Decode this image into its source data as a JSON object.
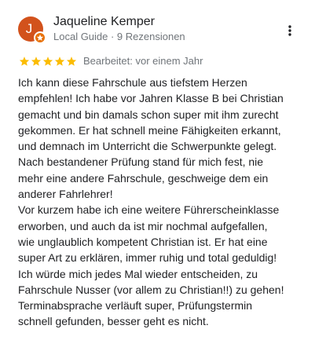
{
  "author": {
    "avatar_initial": "J",
    "name": "Jaqueline Kemper",
    "meta": "Local Guide · 9 Rezensionen",
    "avatar_color": "#d2521c"
  },
  "review": {
    "rating": 5,
    "rating_max": 5,
    "star_color": "#fbbc04",
    "edited": "Bearbeitet: vor einem Jahr",
    "text": "Ich kann diese Fahrschule aus tiefstem Herzen\nempfehlen! Ich habe vor Jahren Klasse B bei Christian\ngemacht und bin damals schon super mit ihm zurecht\ngekommen. Er hat schnell meine Fähigkeiten erkannt,\nund demnach im Unterricht die Schwerpunkte gelegt.\nNach bestandener Prüfung stand für mich fest, nie\nmehr eine andere Fahrschule, geschweige dem ein\nanderer Fahrlehrer!\nVor kurzem habe ich eine weitere Führerscheinklasse\nerworben, und auch da ist mir nochmal aufgefallen,\nwie unglaublich kompetent Christian ist. Er hat eine\nsuper Art zu erklären, immer ruhig und total geduldig!\nIch würde mich jedes Mal wieder entscheiden, zu\nFahrschule Nusser (vor allem zu Christian!!) zu gehen!\nTerminabsprache verläuft super, Prüfungstermin\nschnell gefunden, besser geht es nicht."
  },
  "icons": {
    "more": "more-vert-icon",
    "star": "star-icon",
    "local_guide_badge": "local-guide-badge-icon"
  }
}
